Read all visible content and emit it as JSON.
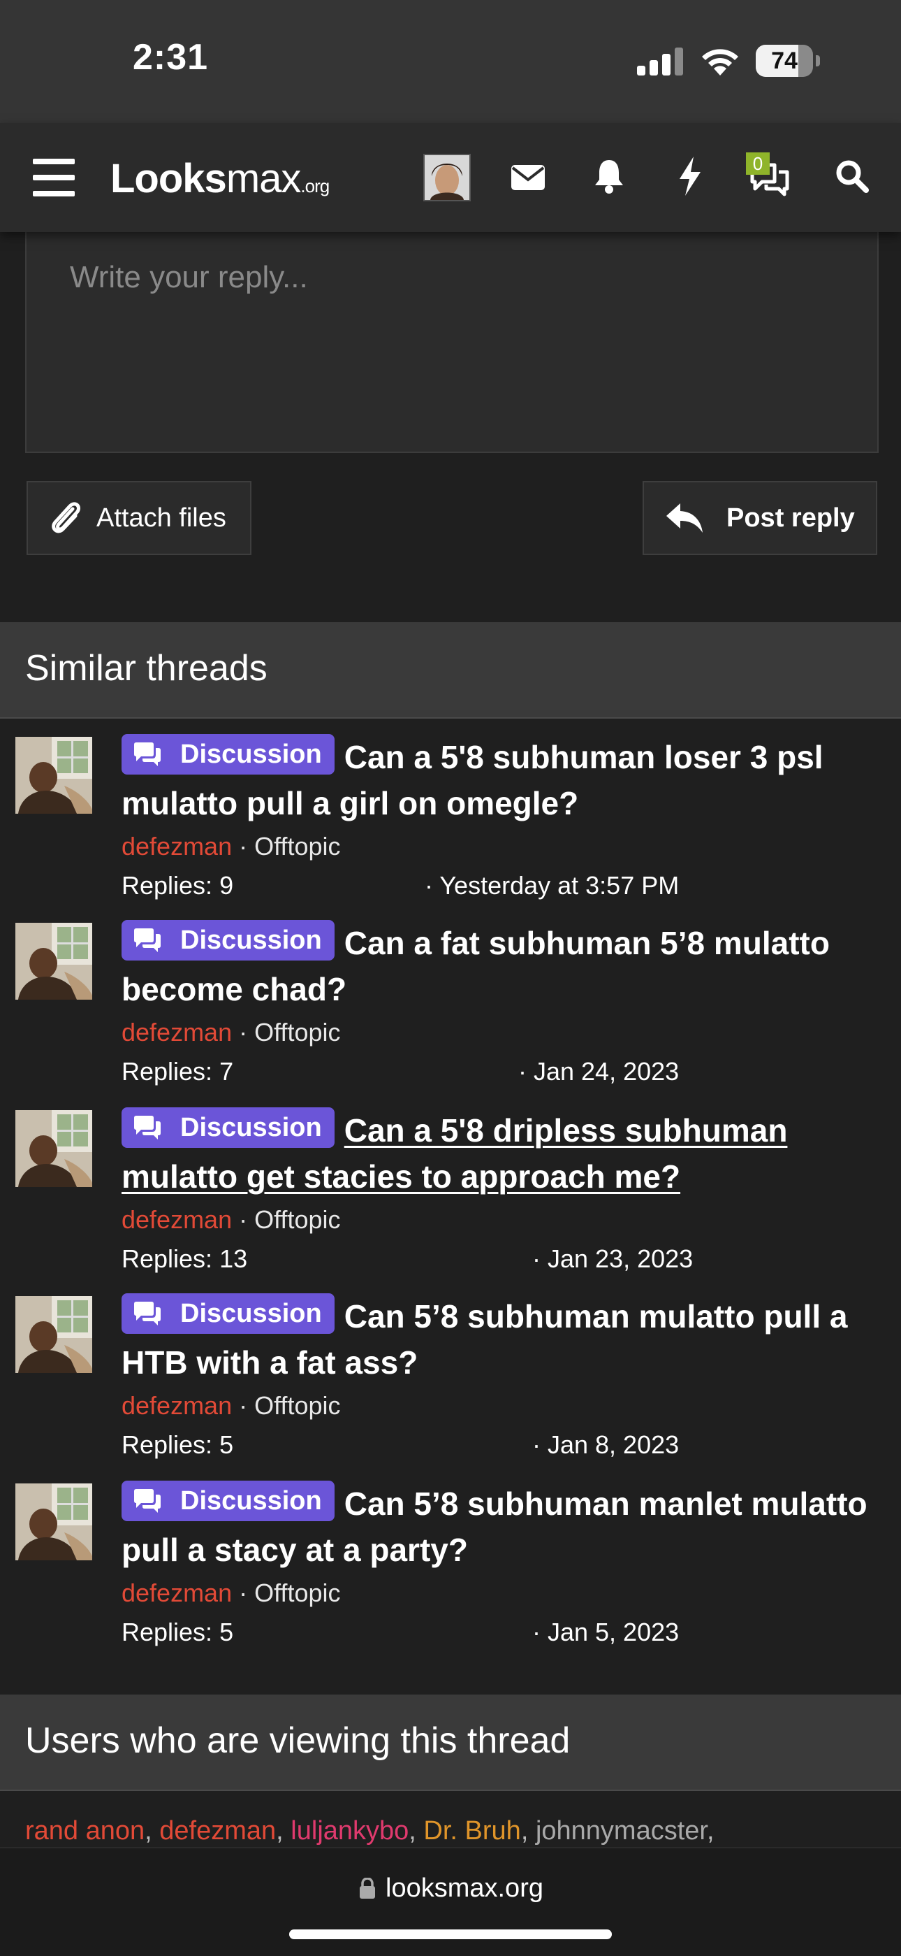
{
  "status_bar": {
    "time": "2:31",
    "battery": "74",
    "battery_fraction": 0.74
  },
  "nav": {
    "logo_part1": "Looks",
    "logo_part2": "max",
    "logo_tld": ".org",
    "conversations_count": "0",
    "icons": [
      "menu-icon",
      "avatar",
      "mail-icon",
      "bell-icon",
      "bolt-icon",
      "chat-icon",
      "search-icon"
    ]
  },
  "reply": {
    "placeholder": "Write your reply...",
    "attach_label": "Attach files",
    "post_label": "Post reply"
  },
  "similar": {
    "title": "Similar threads",
    "threads": [
      {
        "badge": "Discussion",
        "title": "Can a 5'8 subhuman loser 3 psl mulatto pull a girl on omegle?",
        "author": "defezman",
        "forum": "Offtopic",
        "replies": "Replies: 9",
        "date": "· Yesterday at 3:57 PM"
      },
      {
        "badge": "Discussion",
        "title": "Can a fat subhuman 5’8 mulatto become chad?",
        "author": "defezman",
        "forum": "Offtopic",
        "replies": "Replies: 7",
        "date": "· Jan 24, 2023"
      },
      {
        "badge": "Discussion",
        "title": "Can a 5'8 dripless subhuman mulatto get stacies to approach me?",
        "author": "defezman",
        "forum": "Offtopic",
        "replies": "Replies: 13",
        "date": "· Jan 23, 2023"
      },
      {
        "badge": "Discussion",
        "title": "Can 5’8 subhuman mulatto pull a HTB with a fat ass?",
        "author": "defezman",
        "forum": "Offtopic",
        "replies": "Replies: 5",
        "date": "· Jan 8, 2023"
      },
      {
        "badge": "Discussion",
        "title": "Can 5’8 subhuman manlet mulatto pull a stacy at a party?",
        "author": "defezman",
        "forum": "Offtopic",
        "replies": "Replies: 5",
        "date": "· Jan 5, 2023"
      }
    ]
  },
  "viewers": {
    "title": "Users who are viewing this thread",
    "users": [
      "rand anon",
      "defezman",
      "luljankybo",
      "Dr. Bruh",
      "johnnymacster"
    ]
  },
  "browser": {
    "url": "looksmax.org"
  },
  "colors": {
    "accent_badge": "#6b55d8",
    "author": "#e24a37",
    "notification_badge": "#8fb42a"
  }
}
